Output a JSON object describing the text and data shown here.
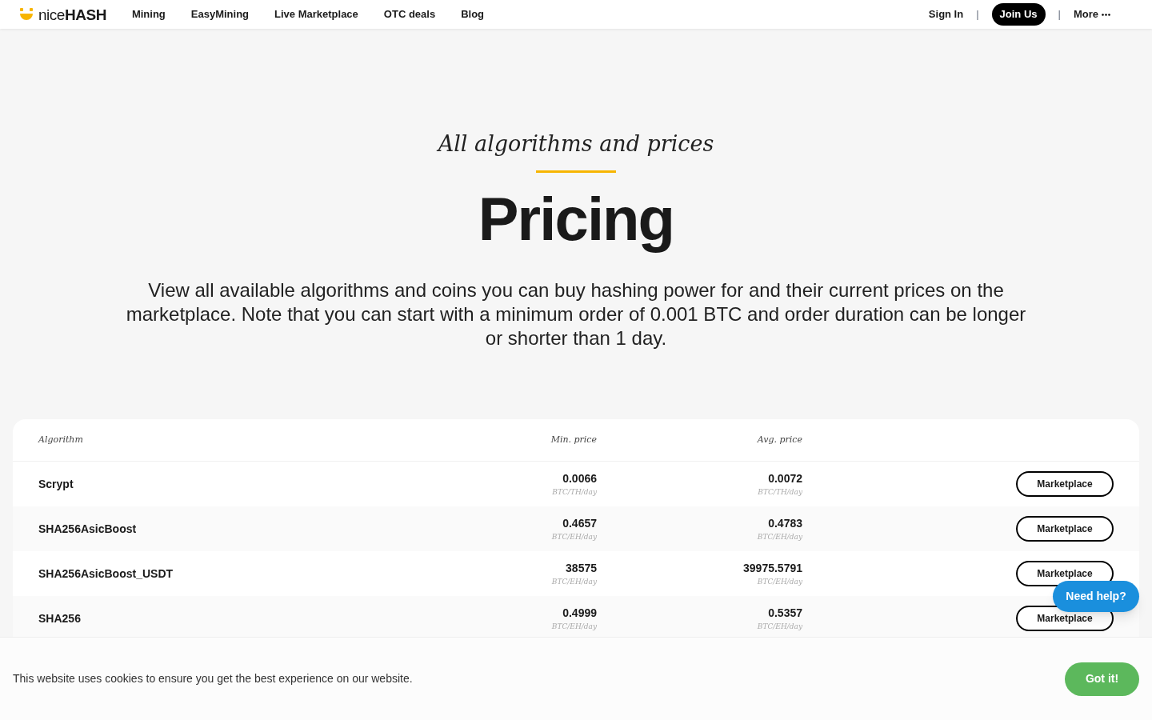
{
  "nav": {
    "logo": {
      "light": "nice",
      "bold": "HASH"
    },
    "links": [
      "Mining",
      "EasyMining",
      "Live Marketplace",
      "OTC deals",
      "Blog"
    ],
    "sign_in": "Sign In",
    "separator": "|",
    "join": "Join Us",
    "more": "More"
  },
  "hero": {
    "subtitle": "All algorithms and prices",
    "title": "Pricing",
    "text": "View all available algorithms and coins you can buy hashing power for and their current prices on the marketplace. Note that you can start with a minimum order of 0.001 BTC and order duration can be longer or shorter than 1 day."
  },
  "table": {
    "columns": [
      "Algorithm",
      "Min. price",
      "Avg. price"
    ],
    "rows": [
      {
        "algorithm": "Scrypt",
        "min": "0.0066",
        "min_unit": "BTC/TH/day",
        "avg": "0.0072",
        "avg_unit": "BTC/TH/day",
        "action": "Marketplace"
      },
      {
        "algorithm": "SHA256AsicBoost",
        "min": "0.4657",
        "min_unit": "BTC/EH/day",
        "avg": "0.4783",
        "avg_unit": "BTC/EH/day",
        "action": "Marketplace"
      },
      {
        "algorithm": "SHA256AsicBoost_USDT",
        "min": "38575",
        "min_unit": "BTC/EH/day",
        "avg": "39975.5791",
        "avg_unit": "BTC/EH/day",
        "action": "Marketplace"
      },
      {
        "algorithm": "SHA256",
        "min": "0.4999",
        "min_unit": "BTC/EH/day",
        "avg": "0.5357",
        "avg_unit": "BTC/EH/day",
        "action": "Marketplace"
      }
    ]
  },
  "help_button": "Need help?",
  "cookie_bar": {
    "text": "This website uses cookies to ensure you get the best experience on our website.",
    "button": "Got it!"
  }
}
